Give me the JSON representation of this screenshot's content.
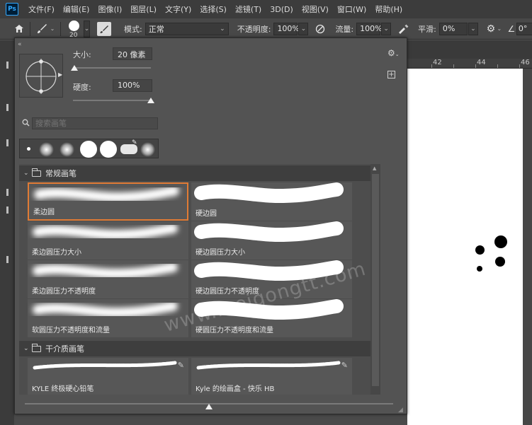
{
  "menu": {
    "items": [
      "文件(F)",
      "编辑(E)",
      "图像(I)",
      "图层(L)",
      "文字(Y)",
      "选择(S)",
      "滤镜(T)",
      "3D(D)",
      "视图(V)",
      "窗口(W)",
      "帮助(H)"
    ]
  },
  "app_logo": "Ps",
  "options_bar": {
    "brush_size": "20",
    "mode_label": "模式:",
    "mode_value": "正常",
    "opacity_label": "不透明度:",
    "opacity_value": "100%",
    "flow_label": "流量:",
    "flow_value": "100%",
    "smoothing_label": "平滑:",
    "smoothing_value": "0%",
    "angle_value": "0°"
  },
  "ruler": {
    "numbers": [
      "42",
      "44",
      "46"
    ]
  },
  "brush_panel": {
    "size_label": "大小:",
    "size_value": "20 像素",
    "hardness_label": "硬度:",
    "hardness_value": "100%",
    "size_fraction": 0.02,
    "hardness_fraction": 1.0,
    "search_placeholder": "搜索画笔",
    "groups": [
      {
        "title": "常规画笔",
        "presets": [
          {
            "name": "柔边圆",
            "kind": "soft",
            "selected": true
          },
          {
            "name": "硬边圆",
            "kind": "hard",
            "selected": false
          },
          {
            "name": "柔边圆压力大小",
            "kind": "soft",
            "selected": false
          },
          {
            "name": "硬边圆压力大小",
            "kind": "hard",
            "selected": false
          },
          {
            "name": "柔边圆压力不透明度",
            "kind": "soft",
            "selected": false
          },
          {
            "name": "硬边圆压力不透明度",
            "kind": "hard",
            "selected": false
          },
          {
            "name": "软圆压力不透明度和流量",
            "kind": "soft",
            "selected": false
          },
          {
            "name": "硬圆压力不透明度和流量",
            "kind": "hard",
            "selected": false
          }
        ]
      },
      {
        "title": "干介质画笔",
        "presets": [
          {
            "name": "KYLE 终极硬心铅笔",
            "kind": "pencil",
            "selected": false
          },
          {
            "name": "Kyle 的绘画盒 - 快乐 HB",
            "kind": "pencil",
            "selected": false
          }
        ]
      }
    ],
    "preview_size_fraction": 0.5
  },
  "watermark": "www.meigongtt.com",
  "icons": {
    "home": "home-icon",
    "brush": "brush-icon",
    "brush_settings": "brush-settings-icon",
    "airbrush": "airbrush-icon",
    "pressure_opacity": "pressure-opacity-icon",
    "pressure_size": "pressure-size-icon",
    "gear": "gear-icon",
    "angle": "angle-icon",
    "search": "search-icon",
    "folder": "folder-icon",
    "pencil": "pencil-icon"
  },
  "colors": {
    "selection_border": "#e07b35",
    "panel_bg": "#535353",
    "canvas": "#ffffff"
  }
}
